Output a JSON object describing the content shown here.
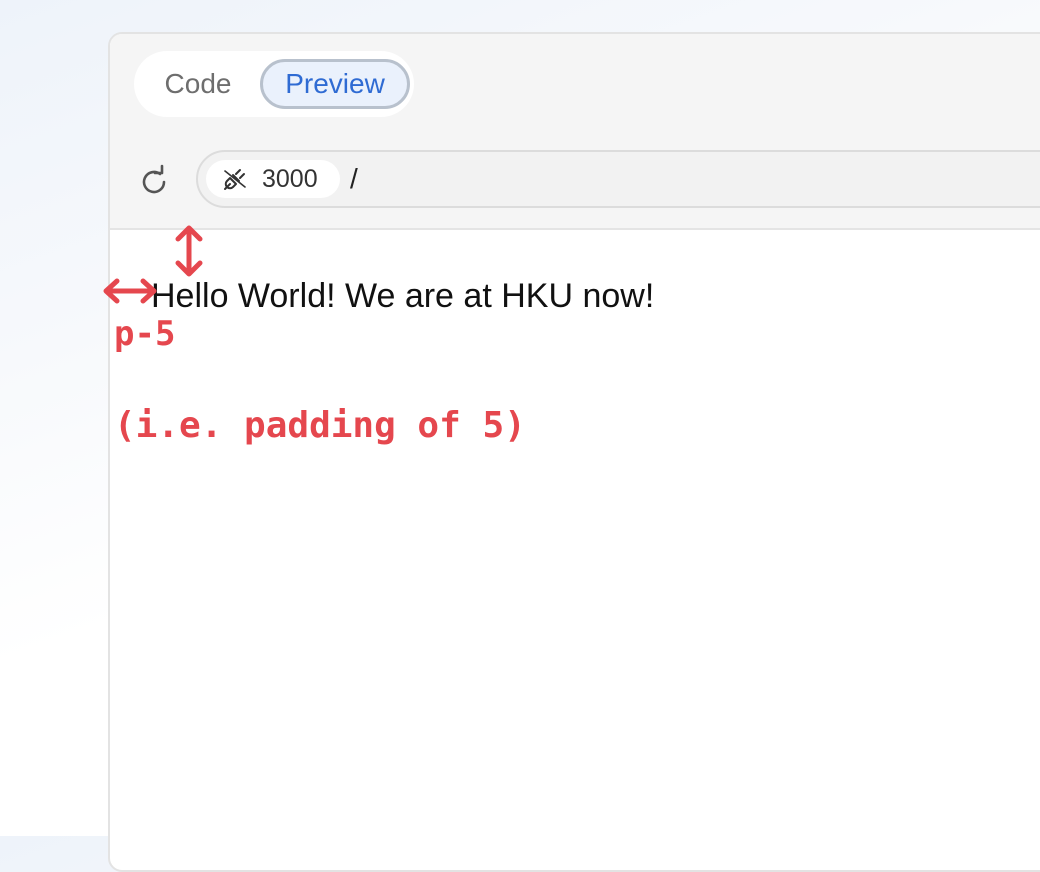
{
  "tabs": {
    "code_label": "Code",
    "preview_label": "Preview",
    "active": "Preview"
  },
  "address_bar": {
    "port": "3000",
    "path": "/"
  },
  "preview": {
    "text": "Hello World! We are at HKU now!"
  },
  "annotation": {
    "class_name": "p-5",
    "description": "(i.e. padding of 5)",
    "color": "#e5474e"
  },
  "icons": {
    "reload": "reload-icon",
    "port": "plug-icon",
    "horizontal_arrow": "double-arrow-horizontal-icon",
    "vertical_arrow": "double-arrow-vertical-icon"
  },
  "colors": {
    "accent": "#2f6bd3",
    "annotation": "#e5474e"
  }
}
